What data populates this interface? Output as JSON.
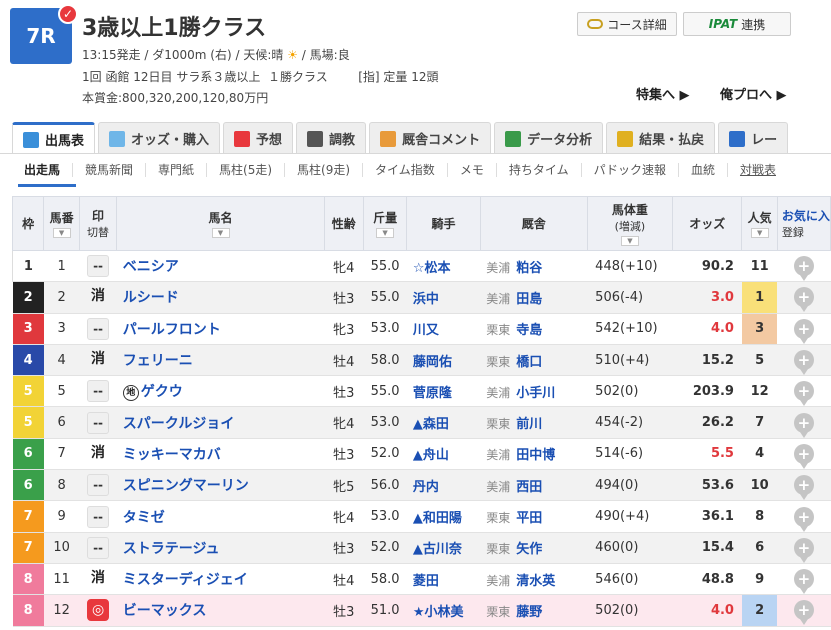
{
  "race": {
    "number": "7R",
    "title": "3歳以上1勝クラス",
    "info1_a": "13:15発走 / ダ1000m (右) / 天候:晴",
    "info1_b": " / 馬場:良",
    "info2": "1回 函館 12日目 サラ系３歳以上  １勝クラス        [指] 定量 12頭",
    "info3": "本賞金:800,320,200,120,80万円"
  },
  "header_buttons": {
    "course": "コース詳細",
    "ipat_logo": "IPAT",
    "ipat": "連携"
  },
  "links": {
    "feature": "特集へ ▶",
    "ore": "俺プロへ ▶"
  },
  "tabs": [
    {
      "label": "出馬表",
      "color": "#3a8fd9"
    },
    {
      "label": "オッズ・購入",
      "color": "#6fb6e8"
    },
    {
      "label": "予想",
      "color": "#e8383d"
    },
    {
      "label": "調教",
      "color": "#555555"
    },
    {
      "label": "厩舎コメント",
      "color": "#e89a3a"
    },
    {
      "label": "データ分析",
      "color": "#3a9a4a"
    },
    {
      "label": "結果・払戻",
      "color": "#e0b020"
    },
    {
      "label": "レー",
      "color": "#2e6ec9"
    }
  ],
  "subnav": [
    "出走馬",
    "競馬新聞",
    "専門紙",
    "馬柱(5走)",
    "馬柱(9走)",
    "タイム指数",
    "メモ",
    "持ちタイム",
    "パドック速報",
    "血統",
    "対戦表"
  ],
  "columns": {
    "waku": "枠",
    "umaban": "馬番",
    "mark": "印",
    "mark_sub": "切替",
    "horse": "馬名",
    "sex": "性齢",
    "kin": "斤量",
    "jockey": "騎手",
    "stable": "厩舎",
    "weight": "馬体重",
    "weight_sub": "(増減)",
    "odds": "オッズ",
    "ninki": "人気",
    "fav": "お気に入",
    "fav_reg": "登録"
  },
  "rows": [
    {
      "waku": "1",
      "umaban": "1",
      "mark": "--",
      "horse": "ベニシア",
      "tag": "",
      "sex": "牝4",
      "kin": "55.0",
      "jockey": "☆松本",
      "region": "美浦",
      "trainer": "粕谷",
      "weight": "448(+10)",
      "odds": "90.2",
      "ninki": "11"
    },
    {
      "waku": "2",
      "umaban": "2",
      "mark": "消",
      "horse": "ルシード",
      "tag": "",
      "sex": "牡3",
      "kin": "55.0",
      "jockey": "浜中",
      "region": "美浦",
      "trainer": "田島",
      "weight": "506(-4)",
      "odds": "3.0",
      "ninki": "1"
    },
    {
      "waku": "3",
      "umaban": "3",
      "mark": "--",
      "horse": "パールフロント",
      "tag": "",
      "sex": "牝3",
      "kin": "53.0",
      "jockey": "川又",
      "region": "栗東",
      "trainer": "寺島",
      "weight": "542(+10)",
      "odds": "4.0",
      "ninki": "3"
    },
    {
      "waku": "4",
      "umaban": "4",
      "mark": "消",
      "horse": "フェリーニ",
      "tag": "",
      "sex": "牡4",
      "kin": "58.0",
      "jockey": "藤岡佑",
      "region": "栗東",
      "trainer": "橋口",
      "weight": "510(+4)",
      "odds": "15.2",
      "ninki": "5"
    },
    {
      "waku": "5",
      "umaban": "5",
      "mark": "--",
      "horse": "ゲクウ",
      "tag": "地",
      "sex": "牡3",
      "kin": "55.0",
      "jockey": "菅原隆",
      "region": "美浦",
      "trainer": "小手川",
      "weight": "502(0)",
      "odds": "203.9",
      "ninki": "12"
    },
    {
      "waku": "5",
      "umaban": "6",
      "mark": "--",
      "horse": "スパークルジョイ",
      "tag": "",
      "sex": "牝4",
      "kin": "53.0",
      "jockey": "▲森田",
      "region": "栗東",
      "trainer": "前川",
      "weight": "454(-2)",
      "odds": "26.2",
      "ninki": "7"
    },
    {
      "waku": "6",
      "umaban": "7",
      "mark": "消",
      "horse": "ミッキーマカバ",
      "tag": "",
      "sex": "牡3",
      "kin": "52.0",
      "jockey": "▲舟山",
      "region": "美浦",
      "trainer": "田中博",
      "weight": "514(-6)",
      "odds": "5.5",
      "ninki": "4"
    },
    {
      "waku": "6",
      "umaban": "8",
      "mark": "--",
      "horse": "スピニングマーリン",
      "tag": "",
      "sex": "牝5",
      "kin": "56.0",
      "jockey": "丹内",
      "region": "美浦",
      "trainer": "西田",
      "weight": "494(0)",
      "odds": "53.6",
      "ninki": "10"
    },
    {
      "waku": "7",
      "umaban": "9",
      "mark": "--",
      "horse": "タミゼ",
      "tag": "",
      "sex": "牝4",
      "kin": "53.0",
      "jockey": "▲和田陽",
      "region": "栗東",
      "trainer": "平田",
      "weight": "490(+4)",
      "odds": "36.1",
      "ninki": "8"
    },
    {
      "waku": "7",
      "umaban": "10",
      "mark": "--",
      "horse": "ストラテージュ",
      "tag": "",
      "sex": "牡3",
      "kin": "52.0",
      "jockey": "▲古川奈",
      "region": "栗東",
      "trainer": "矢作",
      "weight": "460(0)",
      "odds": "15.4",
      "ninki": "6"
    },
    {
      "waku": "8",
      "umaban": "11",
      "mark": "消",
      "horse": "ミスターディジェイ",
      "tag": "",
      "sex": "牡4",
      "kin": "58.0",
      "jockey": "菱田",
      "region": "美浦",
      "trainer": "清水英",
      "weight": "546(0)",
      "odds": "48.8",
      "ninki": "9"
    },
    {
      "waku": "8",
      "umaban": "12",
      "mark": "◎",
      "horse": "ビーマックス",
      "tag": "",
      "sex": "牡3",
      "kin": "51.0",
      "jockey": "★小林美",
      "region": "栗東",
      "trainer": "藤野",
      "weight": "502(0)",
      "odds": "4.0",
      "ninki": "2"
    }
  ]
}
